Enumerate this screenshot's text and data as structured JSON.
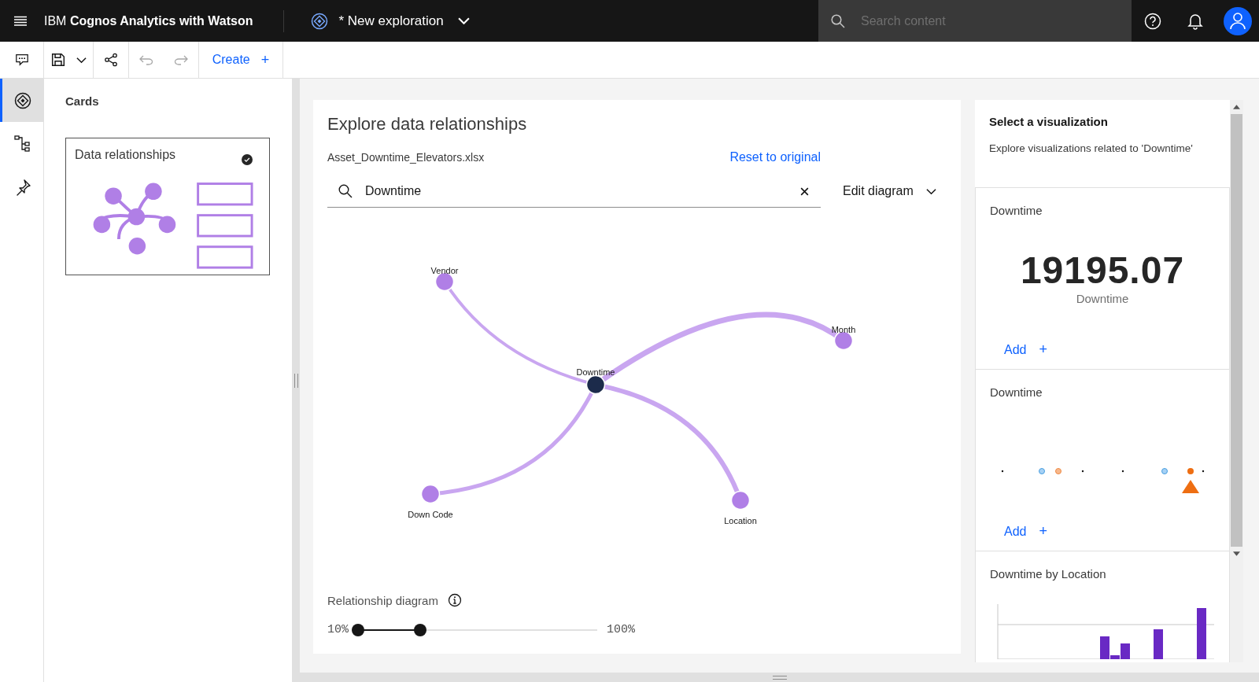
{
  "header": {
    "brand_prefix": "IBM",
    "brand": "Cognos Analytics with Watson",
    "exploration_title": "* New exploration",
    "search": {
      "placeholder": "Search content"
    }
  },
  "toolbar": {
    "create_label": "Create",
    "create_icon": "+"
  },
  "rail": [
    {
      "kind": "explore",
      "selected": true
    },
    {
      "kind": "fields",
      "selected": false
    },
    {
      "kind": "pins",
      "selected": false
    }
  ],
  "cards_panel": {
    "title": "Cards",
    "cards": [
      {
        "label": "Data relationships",
        "checked": true
      }
    ]
  },
  "exploration": {
    "title": "Explore data relationships",
    "file": "Asset_Downtime_Elevators.xlsx",
    "reset_link": "Reset to original",
    "search": {
      "value": "Downtime"
    },
    "edit_menu": "Edit diagram",
    "nodes": [
      {
        "label": "Downtime",
        "kind": "focus"
      },
      {
        "label": "Vendor",
        "kind": "related"
      },
      {
        "label": "Month",
        "kind": "related"
      },
      {
        "label": "Down Code",
        "kind": "related"
      },
      {
        "label": "Location",
        "kind": "related"
      }
    ],
    "slider": {
      "label": "Relationship diagram",
      "min_label": "10%",
      "max_label": "100%",
      "handles": [
        {
          "level": 0
        },
        {
          "level": 0.26
        }
      ]
    }
  },
  "visualizations": {
    "title": "Select a visualization",
    "description": "Explore visualizations related to 'Downtime'",
    "cards": [
      {
        "kind": "kpi",
        "title": "Downtime",
        "value": "19195.07",
        "caption": "Downtime",
        "add_label": "Add",
        "add_icon": "+"
      },
      {
        "kind": "dots",
        "title": "Downtime",
        "add_label": "Add",
        "add_icon": "+"
      },
      {
        "kind": "bars",
        "title": "Downtime by Location"
      }
    ]
  }
}
